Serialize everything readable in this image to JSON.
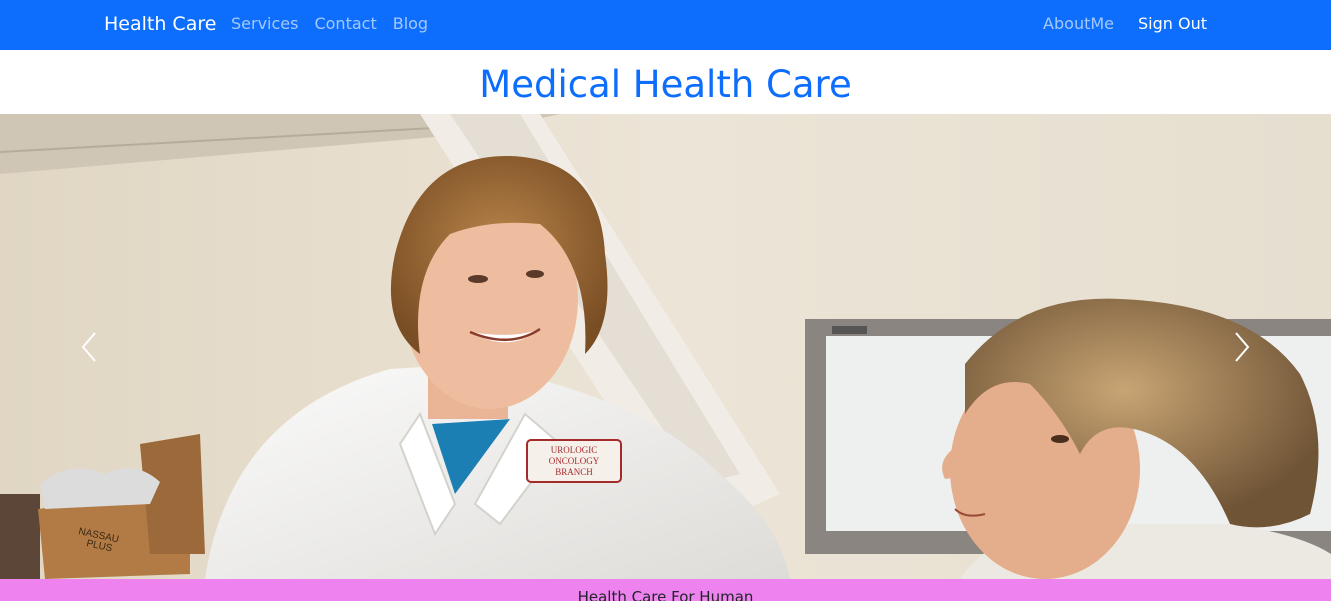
{
  "navbar": {
    "brand": "Health Care",
    "left_links": [
      "Services",
      "Contact",
      "Blog"
    ],
    "right_links": [
      "AboutMe",
      "Sign Out"
    ],
    "background": "#0d6efd"
  },
  "page": {
    "title": "Medical Health Care",
    "title_color": "#0d6efd"
  },
  "carousel": {
    "prev_icon": "chevron-left-icon",
    "next_icon": "chevron-right-icon",
    "badge_text": [
      "UROLOGIC",
      "ONCOLOGY",
      "BRANCH"
    ],
    "box_text": [
      "NASSAU",
      "PLUS"
    ]
  },
  "footer": {
    "text": "Health Care For Human",
    "background": "#ee82ee"
  }
}
